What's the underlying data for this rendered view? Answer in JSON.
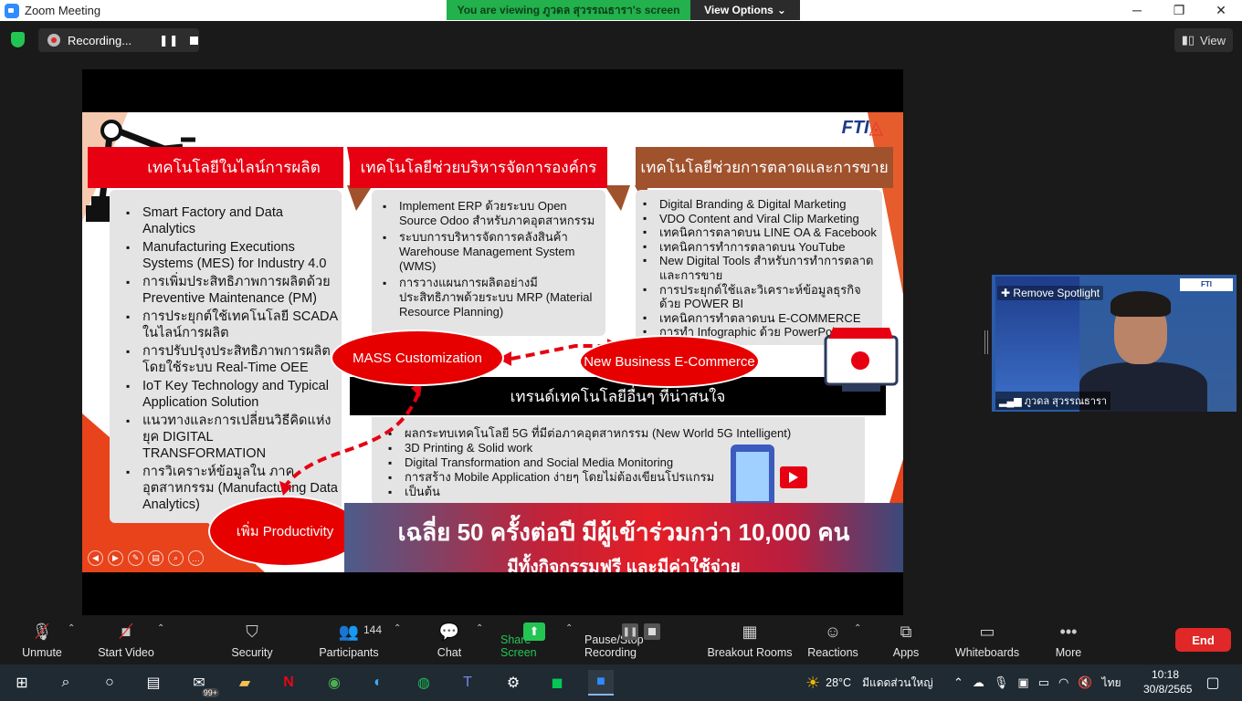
{
  "window": {
    "title": "Zoom Meeting",
    "minimize": "─",
    "maximize": "❐",
    "close": "✕"
  },
  "share_banner": {
    "text": "You are viewing ภูวดล สุวรรณธารา's screen",
    "view_options": "View Options"
  },
  "recording": {
    "label": "Recording..."
  },
  "view_button": {
    "label": "View"
  },
  "slide": {
    "logo_text": "FTI",
    "col1": {
      "header": "เทคโนโลยีในไลน์การผลิต",
      "items": [
        "Smart Factory and Data Analytics",
        "Manufacturing Executions Systems (MES) for Industry 4.0",
        "การเพิ่มประสิทธิภาพการผลิตด้วย Preventive Maintenance (PM)",
        "การประยุกต์ใช้เทคโนโลยี SCADA ในไลน์การผลิต",
        "การปรับปรุงประสิทธิภาพการผลิต โดยใช้ระบบ Real-Time OEE",
        "IoT Key Technology and Typical Application Solution",
        "แนวทางและการเปลี่ยนวิธีคิดแห่งยุค DIGITAL TRANSFORMATION",
        "การวิเคราะห์ข้อมูลใน ภาคอุตสาหกรรม (Manufacturing Data Analytics)"
      ]
    },
    "col2": {
      "header": "เทคโนโลยีช่วยบริหารจัดการองค์กร",
      "items": [
        "Implement ERP ด้วยระบบ Open Source Odoo สำหรับภาคอุตสาหกรรม",
        "ระบบการบริหารจัดการคลังสินค้า Warehouse Management System (WMS)",
        "การวางแผนการผลิตอย่างมี ประสิทธิภาพด้วยระบบ MRP (Material Resource Planning)"
      ]
    },
    "col3": {
      "header": "เทคโนโลยีช่วยการตลาดและการขาย",
      "items": [
        "Digital Branding & Digital Marketing",
        "VDO Content and Viral Clip Marketing",
        "เทคนิคการตลาดบน LINE OA & Facebook",
        "เทคนิคการทำการตลาดบน YouTube",
        "New Digital Tools สำหรับการทำการตลาด และการขาย",
        "การประยุกต์ใช้และวิเคราะห์ข้อมูลธุรกิจด้วย POWER BI",
        "เทคนิคการทำตลาดบน E-COMMERCE",
        "การทำ Infographic ด้วย PowerPoint"
      ]
    },
    "trend": {
      "header": "เทรนด์เทคโนโลยีอื่นๆ ที่น่าสนใจ",
      "items": [
        "ผลกระทบเทคโนโลยี 5G ที่มีต่อภาคอุตสาหกรรม (New World 5G Intelligent)",
        "3D Printing & Solid work",
        "Digital Transformation and Social Media Monitoring",
        "การสร้าง Mobile Application ง่ายๆ โดยไม่ต้องเขียนโปรแกรม",
        "เป็นต้น"
      ]
    },
    "ellipses": {
      "mass": "MASS Customization",
      "ecommerce": "New Business E-Commerce",
      "productivity": "เพิ่ม Productivity"
    },
    "banner": {
      "line1": "เฉลี่ย 50 ครั้งต่อปี มีผู้เข้าร่วมกว่า 10,000 คน",
      "line2": "มีทั้งกิจกรรมฟรี และมีค่าใช้จ่าย"
    }
  },
  "video_tile": {
    "remove_spotlight": "Remove Spotlight",
    "participant_name": "ภูวดล สุวรรณธารา"
  },
  "toolbar": {
    "unmute": "Unmute",
    "start_video": "Start Video",
    "security": "Security",
    "participants": "Participants",
    "participants_count": "144",
    "chat": "Chat",
    "share_screen": "Share Screen",
    "pause_stop_recording": "Pause/Stop Recording",
    "breakout_rooms": "Breakout Rooms",
    "reactions": "Reactions",
    "apps": "Apps",
    "whiteboards": "Whiteboards",
    "more": "More",
    "end": "End"
  },
  "taskbar": {
    "mail_badge": "99+",
    "weather_temp": "28°C",
    "weather_text": "มีแดดส่วนใหญ่",
    "language": "ไทย",
    "time": "10:18",
    "date": "30/8/2565"
  },
  "colors": {
    "header_red": "#e60012",
    "header_brown": "#a0522d",
    "share_green": "#22b14c",
    "end_red": "#e02828"
  }
}
